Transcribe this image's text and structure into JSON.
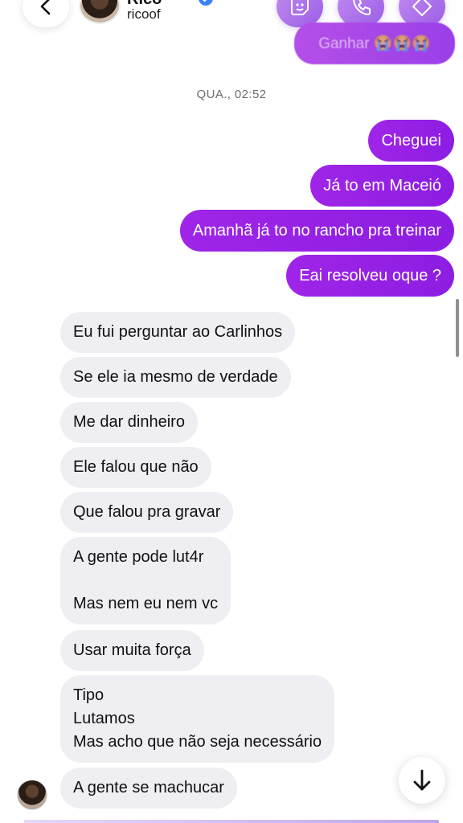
{
  "header": {
    "contact_name": "Rico",
    "username": "ricoof",
    "pinned_preview": "Ganhar 😭😭😭"
  },
  "timestamp": "QUA., 02:52",
  "outgoing": [
    "Cheguei",
    "Já to em Maceió",
    "Amanhã já to no rancho pra treinar",
    "Eai resolveu oque ?"
  ],
  "incoming": [
    "Eu fui perguntar ao Carlinhos",
    "Se ele ia mesmo de verdade",
    "Me dar dinheiro",
    "Ele falou que não",
    "Que falou pra gravar",
    "A gente pode lut4r\n\nMas nem eu nem vc",
    "Usar muita força",
    "Tipo\nLutamos\nMas acho que não seja necessário",
    "A gente se machucar"
  ],
  "colors": {
    "outgoing_bubble": "#9a24e6",
    "incoming_bubble": "#efeff3",
    "timestamp_text": "#6b6b6b"
  },
  "icons": {
    "back": "chevron-left-icon",
    "sticker": "sticker-icon",
    "call": "phone-icon",
    "tag": "tag-icon",
    "scroll_down": "arrow-down-icon"
  }
}
